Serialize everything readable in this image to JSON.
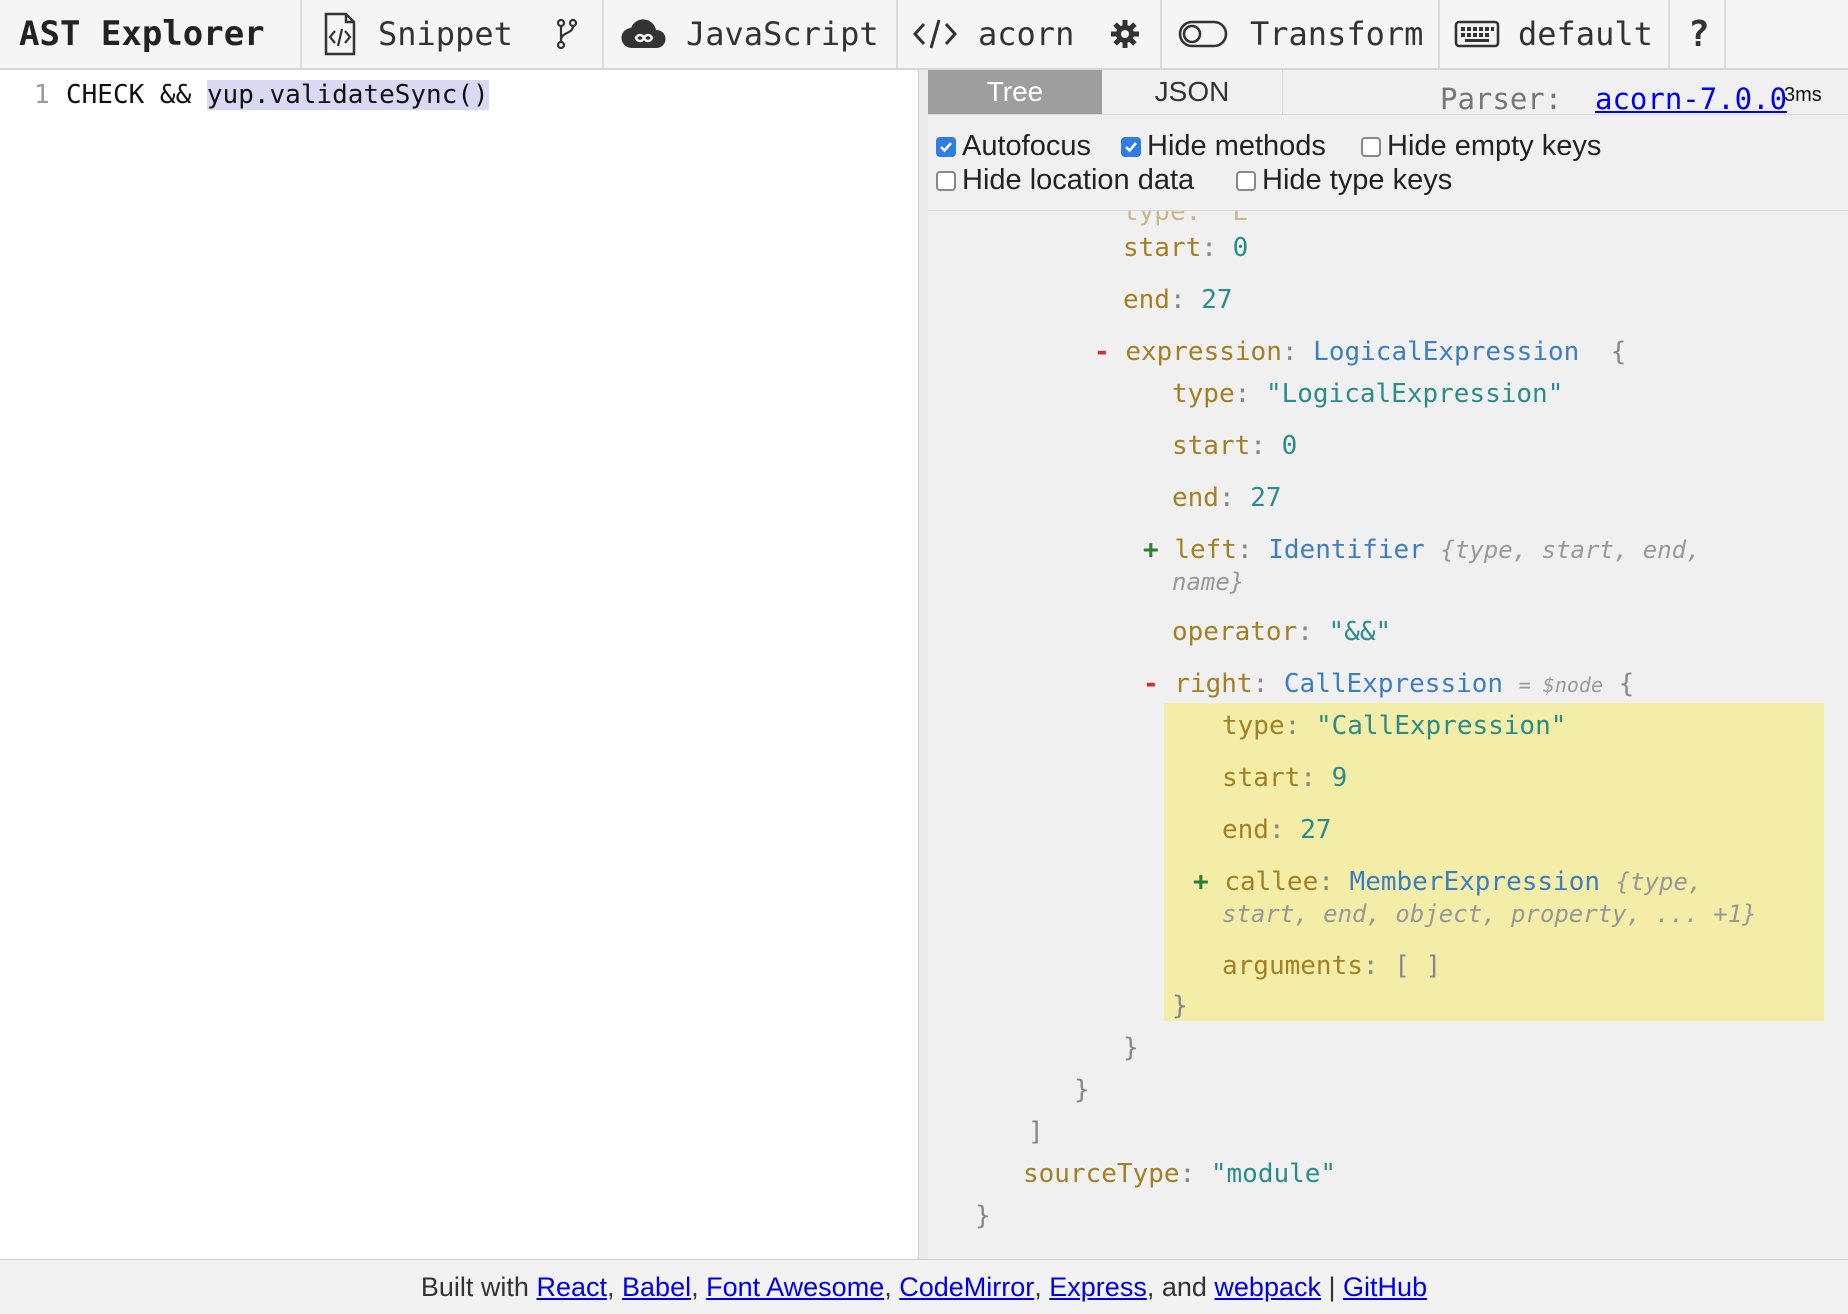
{
  "toolbar": {
    "title": "AST Explorer",
    "snippet_label": "Snippet",
    "language_label": "JavaScript",
    "parser_label": "acorn",
    "transform_label": "Transform",
    "keymap_label": "default",
    "help_label": "?",
    "icons": [
      "snippet-file-icon",
      "fork-icon",
      "cloud-icon",
      "code-icon",
      "gear-icon",
      "toggle-icon",
      "keyboard-icon",
      "help-icon"
    ]
  },
  "editor": {
    "line_number": "1",
    "code_plain": "CHECK && ",
    "code_selected": "yup.validateSync()"
  },
  "output": {
    "tabs": {
      "tree": "Tree",
      "json": "JSON"
    },
    "parser_prefix": "Parser:",
    "parser_link": "acorn-7.0.0",
    "parse_time": "3ms",
    "options": {
      "autofocus": {
        "label": "Autofocus",
        "checked": true
      },
      "hide_methods": {
        "label": "Hide methods",
        "checked": true
      },
      "hide_empty_keys": {
        "label": "Hide empty keys",
        "checked": false
      },
      "hide_location_data": {
        "label": "Hide location data",
        "checked": false
      },
      "hide_type_keys": {
        "label": "Hide type keys",
        "checked": false
      }
    },
    "tree": {
      "stmt_start_key": "start",
      "stmt_start_val": "0",
      "stmt_end_key": "end",
      "stmt_end_val": "27",
      "expression_key": "expression",
      "expression_type": "LogicalExpression",
      "open_brace": "{",
      "le_type_key": "type",
      "le_type_val": "\"LogicalExpression\"",
      "le_start_key": "start",
      "le_start_val": "0",
      "le_end_key": "end",
      "le_end_val": "27",
      "left_key": "left",
      "left_type": "Identifier",
      "left_summary_1": "{type, start, end,",
      "left_summary_2": "name}",
      "operator_key": "operator",
      "operator_val": "\"&&\"",
      "right_key": "right",
      "right_type": "CallExpression",
      "right_ref": "= $node",
      "ce_type_key": "type",
      "ce_type_val": "\"CallExpression\"",
      "ce_start_key": "start",
      "ce_start_val": "9",
      "ce_end_key": "end",
      "ce_end_val": "27",
      "callee_key": "callee",
      "callee_type": "MemberExpression",
      "callee_summary_1": "{type,",
      "callee_summary_2": "start, end, object, property, ... +1}",
      "arguments_key": "arguments",
      "arguments_val": "[ ]",
      "close_brace": "}",
      "close_bracket": "]",
      "source_type_key": "sourceType",
      "source_type_val": "\"module\"",
      "toggle_minus": "-",
      "toggle_plus": "+",
      "colon": ":"
    }
  },
  "footer": {
    "prefix": "Built with",
    "links": [
      "React",
      "Babel",
      "Font Awesome",
      "CodeMirror",
      "Express",
      "webpack",
      "GitHub"
    ],
    "and_text": "and",
    "pipe": "|"
  }
}
